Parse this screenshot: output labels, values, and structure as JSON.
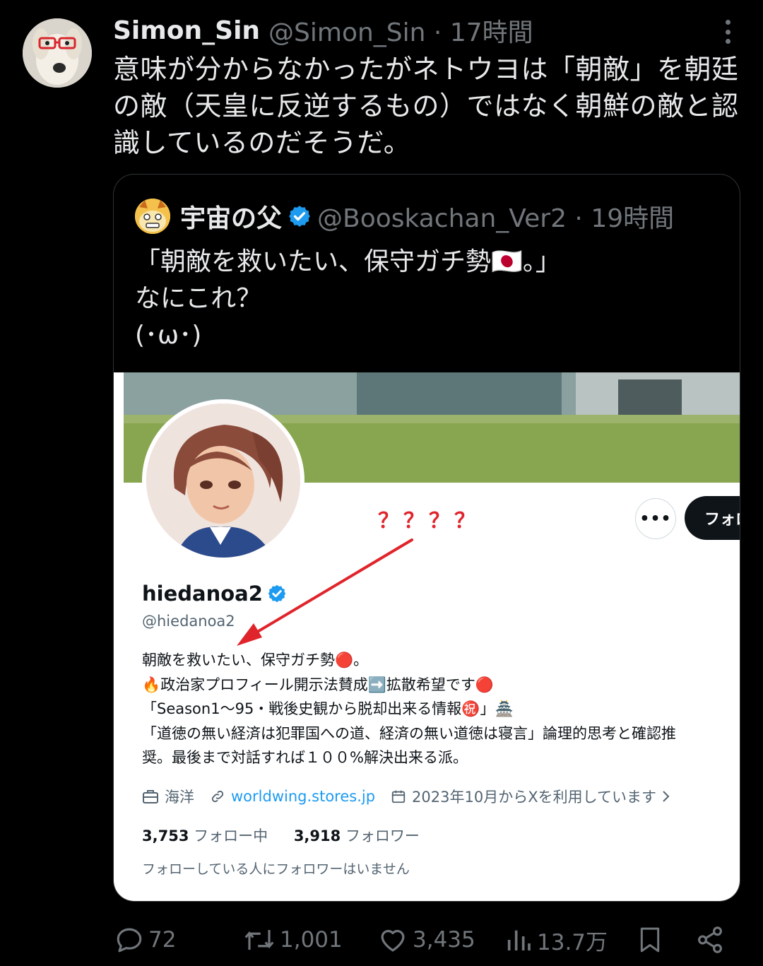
{
  "tweet": {
    "author_name": "Simon_Sin",
    "author_handle": "@Simon_Sin",
    "time": "17時間",
    "text": "意味が分からなかったがネトウヨは「朝敵」を朝廷の敵（天皇に反逆するもの）ではなく朝鮮の敵と認識しているのだそうだ。"
  },
  "quote": {
    "author_name": "宇宙の父",
    "author_handle": "@Booskachan_Ver2",
    "time": "19時間",
    "text": "「朝敵を救いたい、保守ガチ勢🇯🇵。」\nなにこれ？\n(･ω･)"
  },
  "embedded_profile": {
    "annotation": "？？？？",
    "more_label": "•••",
    "follow_label": "フォロ",
    "name": "hiedanoa2",
    "handle": "@hiedanoa2",
    "bio": "朝敵を救いたい、保守ガチ勢🔴。\n🔥政治家プロフィール開示法賛成➡️拡散希望です🔴\n「Season1～95・戦後史観から脱却出来る情報㊗️」🏯\n「道徳の無い経済は犯罪国への道、経済の無い道徳は寝言」論理的思考と確認推\n奨。最後まで対話すれば１００%解決出来る派。",
    "location": "海洋",
    "website": "worldwing.stores.jp",
    "joined": "2023年10月からXを利用しています",
    "following_count": "3,753",
    "following_label": "フォロー中",
    "followers_count": "3,918",
    "followers_label": "フォロワー",
    "note": "フォローしている人にフォロワーはいません"
  },
  "actions": {
    "replies": "72",
    "retweets": "1,001",
    "likes": "3,435",
    "views": "13.7万"
  },
  "colors": {
    "background": "#000000",
    "text": "#e7e9ea",
    "muted": "#71767b",
    "verified": "#1d9bf0",
    "annotation": "#e0242b"
  },
  "icons": [
    "more-icon",
    "verified-icon",
    "briefcase-icon",
    "link-icon",
    "calendar-icon",
    "chevron-right-icon",
    "reply-icon",
    "retweet-icon",
    "like-icon",
    "views-icon",
    "bookmark-icon",
    "share-icon"
  ]
}
